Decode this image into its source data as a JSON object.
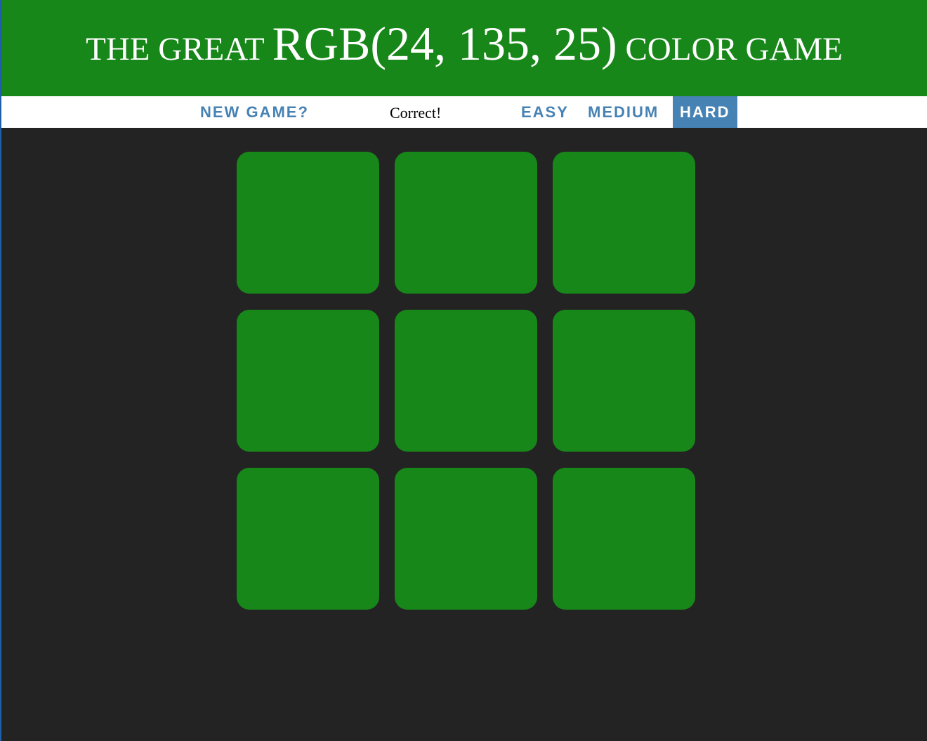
{
  "header": {
    "title_prefix": "The Great",
    "rgb_display": "RGB(24, 135, 25)",
    "title_suffix": "Color Game",
    "background_color": "#188719"
  },
  "stripe": {
    "new_game_label": "New Game?",
    "message": "Correct!",
    "modes": [
      {
        "label": "Easy",
        "selected": false
      },
      {
        "label": "Medium",
        "selected": false
      },
      {
        "label": "Hard",
        "selected": true
      }
    ],
    "accent_color": "#4682b4"
  },
  "board": {
    "background_color": "#232323",
    "squares": [
      {
        "color": "#188719"
      },
      {
        "color": "#188719"
      },
      {
        "color": "#188719"
      },
      {
        "color": "#188719"
      },
      {
        "color": "#188719"
      },
      {
        "color": "#188719"
      },
      {
        "color": "#188719"
      },
      {
        "color": "#188719"
      },
      {
        "color": "#188719"
      }
    ]
  }
}
